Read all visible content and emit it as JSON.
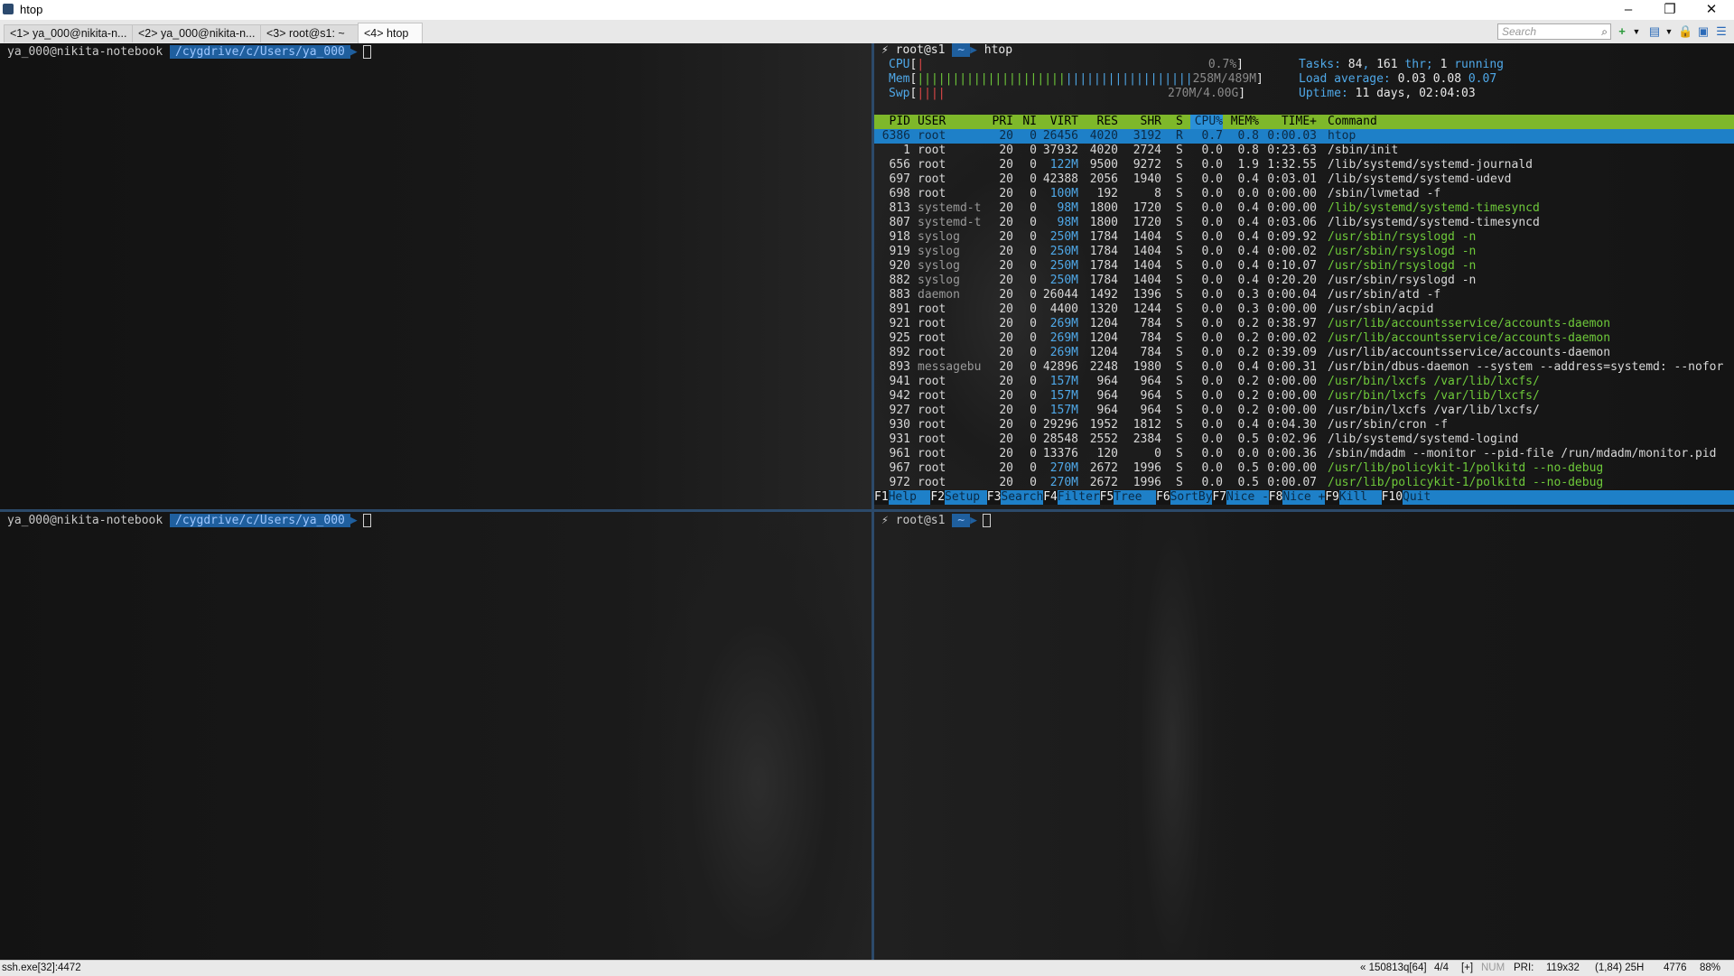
{
  "window": {
    "title": "htop",
    "minimize": "–",
    "maximize": "❐",
    "close": "✕"
  },
  "tabs": [
    {
      "label": "<1> ya_000@nikita-n..."
    },
    {
      "label": "<2> ya_000@nikita-n..."
    },
    {
      "label": "<3> root@s1: ~"
    },
    {
      "label": "<4> htop"
    }
  ],
  "search": {
    "placeholder": "Search",
    "icon": "search-icon"
  },
  "toolbar_icons": [
    "new-console-icon",
    "dropdown-icon",
    "layout-icon",
    "dropdown-icon",
    "lock-icon",
    "window-icon",
    "menu-icon"
  ],
  "panes": {
    "top_left": {
      "user": "ya_000@nikita-notebook",
      "path": "/cygdrive/c/Users/ya_000"
    },
    "bottom_left": {
      "user": "ya_000@nikita-notebook",
      "path": "/cygdrive/c/Users/ya_000"
    },
    "top_right": {
      "bolt": "⚡",
      "user": "root@s1",
      "path": "~",
      "command": "htop"
    },
    "bottom_right": {
      "bolt": "⚡",
      "user": "root@s1",
      "path": "~"
    }
  },
  "htop": {
    "cpu": {
      "label": "CPU",
      "value": "0.7%"
    },
    "mem": {
      "label": "Mem",
      "value": "258M/489M"
    },
    "swp": {
      "label": "Swp",
      "value": "270M/4.00G"
    },
    "tasks": {
      "label": "Tasks:",
      "tasks": "84",
      "threads": "161",
      "thr_label": "thr;",
      "running": "1",
      "running_label": "running"
    },
    "load": {
      "label": "Load average:",
      "v1": "0.03",
      "v2": "0.08",
      "v3": "0.07"
    },
    "uptime": {
      "label": "Uptime:",
      "value": "11 days, 02:04:03"
    },
    "columns": [
      "PID",
      "USER",
      "PRI",
      "NI",
      "VIRT",
      "RES",
      "SHR",
      "S",
      "CPU%",
      "MEM%",
      "TIME+",
      "Command"
    ],
    "processes": [
      {
        "pid": "6386",
        "user": "root",
        "pri": "20",
        "ni": "0",
        "virt": "26456",
        "res": "4020",
        "shr": "3192",
        "s": "R",
        "cpu": "0.7",
        "mem": "0.8",
        "time": "0:00.03",
        "cmd": "htop"
      },
      {
        "pid": "1",
        "user": "root",
        "pri": "20",
        "ni": "0",
        "virt": "37932",
        "res": "4020",
        "shr": "2724",
        "s": "S",
        "cpu": "0.0",
        "mem": "0.8",
        "time": "0:23.63",
        "cmd": "/sbin/init"
      },
      {
        "pid": "656",
        "user": "root",
        "pri": "20",
        "ni": "0",
        "virt": "122M",
        "res": "9500",
        "shr": "9272",
        "s": "S",
        "cpu": "0.0",
        "mem": "1.9",
        "time": "1:32.55",
        "cmd": "/lib/systemd/systemd-journald"
      },
      {
        "pid": "697",
        "user": "root",
        "pri": "20",
        "ni": "0",
        "virt": "42388",
        "res": "2056",
        "shr": "1940",
        "s": "S",
        "cpu": "0.0",
        "mem": "0.4",
        "time": "0:03.01",
        "cmd": "/lib/systemd/systemd-udevd"
      },
      {
        "pid": "698",
        "user": "root",
        "pri": "20",
        "ni": "0",
        "virt": "100M",
        "res": "192",
        "shr": "8",
        "s": "S",
        "cpu": "0.0",
        "mem": "0.0",
        "time": "0:00.00",
        "cmd": "/sbin/lvmetad -f"
      },
      {
        "pid": "813",
        "user": "systemd-t",
        "pri": "20",
        "ni": "0",
        "virt": "98M",
        "res": "1800",
        "shr": "1720",
        "s": "S",
        "cpu": "0.0",
        "mem": "0.4",
        "time": "0:00.00",
        "cmd": "/lib/systemd/systemd-timesyncd",
        "thread": true
      },
      {
        "pid": "807",
        "user": "systemd-t",
        "pri": "20",
        "ni": "0",
        "virt": "98M",
        "res": "1800",
        "shr": "1720",
        "s": "S",
        "cpu": "0.0",
        "mem": "0.4",
        "time": "0:03.06",
        "cmd": "/lib/systemd/systemd-timesyncd"
      },
      {
        "pid": "918",
        "user": "syslog",
        "pri": "20",
        "ni": "0",
        "virt": "250M",
        "res": "1784",
        "shr": "1404",
        "s": "S",
        "cpu": "0.0",
        "mem": "0.4",
        "time": "0:09.92",
        "cmd": "/usr/sbin/rsyslogd -n",
        "thread": true
      },
      {
        "pid": "919",
        "user": "syslog",
        "pri": "20",
        "ni": "0",
        "virt": "250M",
        "res": "1784",
        "shr": "1404",
        "s": "S",
        "cpu": "0.0",
        "mem": "0.4",
        "time": "0:00.02",
        "cmd": "/usr/sbin/rsyslogd -n",
        "thread": true
      },
      {
        "pid": "920",
        "user": "syslog",
        "pri": "20",
        "ni": "0",
        "virt": "250M",
        "res": "1784",
        "shr": "1404",
        "s": "S",
        "cpu": "0.0",
        "mem": "0.4",
        "time": "0:10.07",
        "cmd": "/usr/sbin/rsyslogd -n",
        "thread": true
      },
      {
        "pid": "882",
        "user": "syslog",
        "pri": "20",
        "ni": "0",
        "virt": "250M",
        "res": "1784",
        "shr": "1404",
        "s": "S",
        "cpu": "0.0",
        "mem": "0.4",
        "time": "0:20.20",
        "cmd": "/usr/sbin/rsyslogd -n"
      },
      {
        "pid": "883",
        "user": "daemon",
        "pri": "20",
        "ni": "0",
        "virt": "26044",
        "res": "1492",
        "shr": "1396",
        "s": "S",
        "cpu": "0.0",
        "mem": "0.3",
        "time": "0:00.04",
        "cmd": "/usr/sbin/atd -f"
      },
      {
        "pid": "891",
        "user": "root",
        "pri": "20",
        "ni": "0",
        "virt": "4400",
        "res": "1320",
        "shr": "1244",
        "s": "S",
        "cpu": "0.0",
        "mem": "0.3",
        "time": "0:00.00",
        "cmd": "/usr/sbin/acpid"
      },
      {
        "pid": "921",
        "user": "root",
        "pri": "20",
        "ni": "0",
        "virt": "269M",
        "res": "1204",
        "shr": "784",
        "s": "S",
        "cpu": "0.0",
        "mem": "0.2",
        "time": "0:38.97",
        "cmd": "/usr/lib/accountsservice/accounts-daemon",
        "thread": true
      },
      {
        "pid": "925",
        "user": "root",
        "pri": "20",
        "ni": "0",
        "virt": "269M",
        "res": "1204",
        "shr": "784",
        "s": "S",
        "cpu": "0.0",
        "mem": "0.2",
        "time": "0:00.02",
        "cmd": "/usr/lib/accountsservice/accounts-daemon",
        "thread": true
      },
      {
        "pid": "892",
        "user": "root",
        "pri": "20",
        "ni": "0",
        "virt": "269M",
        "res": "1204",
        "shr": "784",
        "s": "S",
        "cpu": "0.0",
        "mem": "0.2",
        "time": "0:39.09",
        "cmd": "/usr/lib/accountsservice/accounts-daemon"
      },
      {
        "pid": "893",
        "user": "messagebu",
        "pri": "20",
        "ni": "0",
        "virt": "42896",
        "res": "2248",
        "shr": "1980",
        "s": "S",
        "cpu": "0.0",
        "mem": "0.4",
        "time": "0:00.31",
        "cmd": "/usr/bin/dbus-daemon --system --address=systemd: --nofor"
      },
      {
        "pid": "941",
        "user": "root",
        "pri": "20",
        "ni": "0",
        "virt": "157M",
        "res": "964",
        "shr": "964",
        "s": "S",
        "cpu": "0.0",
        "mem": "0.2",
        "time": "0:00.00",
        "cmd": "/usr/bin/lxcfs /var/lib/lxcfs/",
        "thread": true
      },
      {
        "pid": "942",
        "user": "root",
        "pri": "20",
        "ni": "0",
        "virt": "157M",
        "res": "964",
        "shr": "964",
        "s": "S",
        "cpu": "0.0",
        "mem": "0.2",
        "time": "0:00.00",
        "cmd": "/usr/bin/lxcfs /var/lib/lxcfs/",
        "thread": true
      },
      {
        "pid": "927",
        "user": "root",
        "pri": "20",
        "ni": "0",
        "virt": "157M",
        "res": "964",
        "shr": "964",
        "s": "S",
        "cpu": "0.0",
        "mem": "0.2",
        "time": "0:00.00",
        "cmd": "/usr/bin/lxcfs /var/lib/lxcfs/"
      },
      {
        "pid": "930",
        "user": "root",
        "pri": "20",
        "ni": "0",
        "virt": "29296",
        "res": "1952",
        "shr": "1812",
        "s": "S",
        "cpu": "0.0",
        "mem": "0.4",
        "time": "0:04.30",
        "cmd": "/usr/sbin/cron -f"
      },
      {
        "pid": "931",
        "user": "root",
        "pri": "20",
        "ni": "0",
        "virt": "28548",
        "res": "2552",
        "shr": "2384",
        "s": "S",
        "cpu": "0.0",
        "mem": "0.5",
        "time": "0:02.96",
        "cmd": "/lib/systemd/systemd-logind"
      },
      {
        "pid": "961",
        "user": "root",
        "pri": "20",
        "ni": "0",
        "virt": "13376",
        "res": "120",
        "shr": "0",
        "s": "S",
        "cpu": "0.0",
        "mem": "0.0",
        "time": "0:00.36",
        "cmd": "/sbin/mdadm --monitor --pid-file /run/mdadm/monitor.pid"
      },
      {
        "pid": "967",
        "user": "root",
        "pri": "20",
        "ni": "0",
        "virt": "270M",
        "res": "2672",
        "shr": "1996",
        "s": "S",
        "cpu": "0.0",
        "mem": "0.5",
        "time": "0:00.00",
        "cmd": "/usr/lib/policykit-1/polkitd --no-debug",
        "thread": true
      },
      {
        "pid": "972",
        "user": "root",
        "pri": "20",
        "ni": "0",
        "virt": "270M",
        "res": "2672",
        "shr": "1996",
        "s": "S",
        "cpu": "0.0",
        "mem": "0.5",
        "time": "0:00.07",
        "cmd": "/usr/lib/policykit-1/polkitd --no-debug",
        "thread": true
      }
    ],
    "fkeys": [
      {
        "key": "F1",
        "label": "Help"
      },
      {
        "key": "F2",
        "label": "Setup"
      },
      {
        "key": "F3",
        "label": "Search"
      },
      {
        "key": "F4",
        "label": "Filter"
      },
      {
        "key": "F5",
        "label": "Tree"
      },
      {
        "key": "F6",
        "label": "SortBy"
      },
      {
        "key": "F7",
        "label": "Nice -"
      },
      {
        "key": "F8",
        "label": "Nice +"
      },
      {
        "key": "F9",
        "label": "Kill"
      },
      {
        "key": "F10",
        "label": "Quit"
      }
    ]
  },
  "statusbar": {
    "left": "ssh.exe[32]:4472",
    "pos": "« 150813q[64]",
    "pane": "4/4",
    "mod": "[+]",
    "num": "NUM",
    "pri": "PRI:",
    "size": "119x32",
    "cursor": "(1,84) 25H",
    "pid": "4776",
    "zoom": "88%"
  },
  "colors": {
    "accent": "#1e80c8",
    "header": "#7eb82a",
    "path_bg": "#1f5f9e"
  }
}
